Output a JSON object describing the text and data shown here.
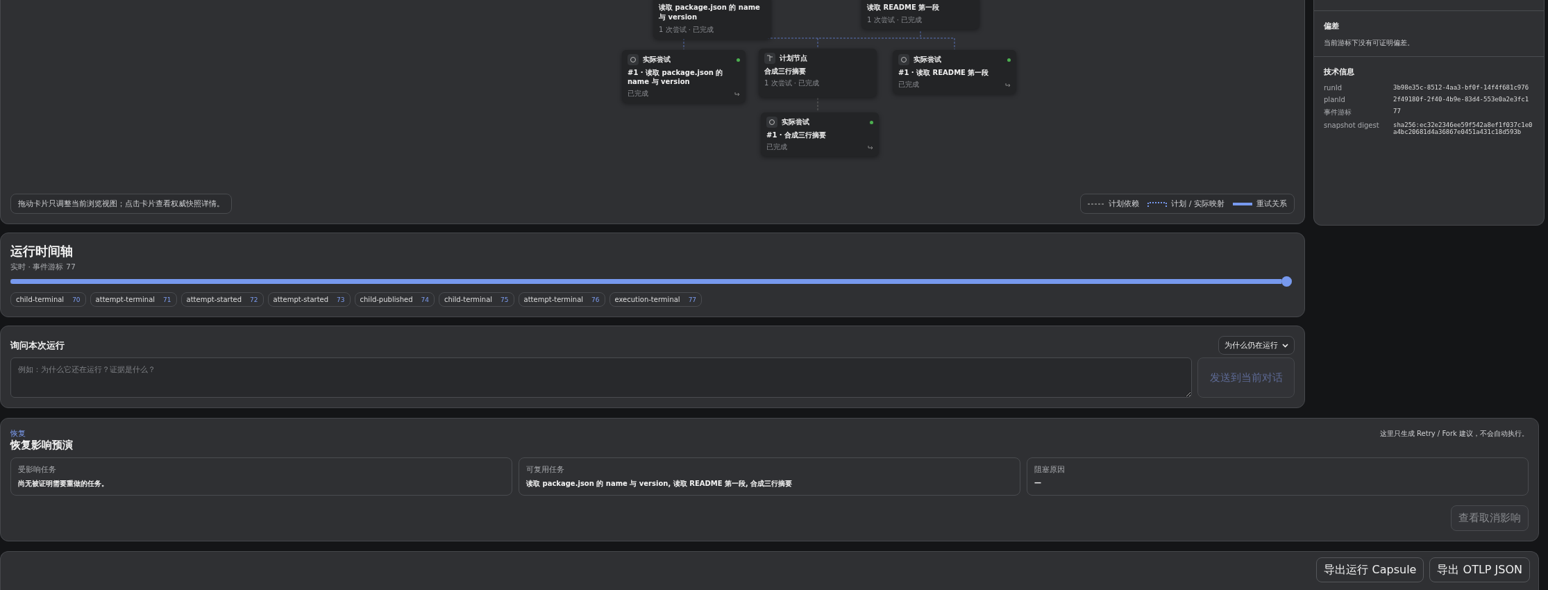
{
  "graph": {
    "nodes": [
      {
        "kind": "planned",
        "title": "读取 package.json 的 name 与 version",
        "meta": "1 次尝试 · 已完成"
      },
      {
        "kind": "planned",
        "title": "读取 README 第一段",
        "meta": "1 次尝试 · 已完成"
      },
      {
        "kind": "attempt",
        "title": "实际尝试",
        "task": "#1 · 读取 package.json 的 name 与 version",
        "status": "已完成"
      },
      {
        "kind": "plan",
        "title": "计划节点",
        "task": "合成三行摘要",
        "meta": "1 次尝试 · 已完成"
      },
      {
        "kind": "attempt",
        "title": "实际尝试",
        "task": "#1 · 读取 README 第一段",
        "status": "已完成"
      },
      {
        "kind": "attempt",
        "title": "实际尝试",
        "task": "#1 · 合成三行摘要",
        "status": "已完成"
      }
    ],
    "hint": "拖动卡片只调整当前浏览视图；点击卡片查看权威快照详情。",
    "legend": [
      {
        "kind": "dashed",
        "label": "计划依赖"
      },
      {
        "kind": "mapping",
        "label": "计划 / 实际映射"
      },
      {
        "kind": "retry",
        "label": "重试关系"
      }
    ]
  },
  "timeline": {
    "title": "运行时间轴",
    "subtitle": "实时 · 事件游标 77",
    "level": 1,
    "events": [
      {
        "name": "child-terminal",
        "seq": "70"
      },
      {
        "name": "attempt-terminal",
        "seq": "71"
      },
      {
        "name": "attempt-started",
        "seq": "72"
      },
      {
        "name": "attempt-started",
        "seq": "73"
      },
      {
        "name": "child-published",
        "seq": "74"
      },
      {
        "name": "child-terminal",
        "seq": "75"
      },
      {
        "name": "attempt-terminal",
        "seq": "76"
      },
      {
        "name": "execution-terminal",
        "seq": "77"
      }
    ]
  },
  "ask": {
    "title": "询问本次运行",
    "select": "为什么仍在运行",
    "placeholder": "例如：为什么它还在运行？证据是什么？",
    "send": {
      "label": "发送到当前对话",
      "disabled": true
    }
  },
  "recovery": {
    "eyebrow": "恢复",
    "title": "恢复影响预演",
    "note": "这里只生成 Retry / Fork 建议，不会自动执行。",
    "cards": [
      {
        "label": "受影响任务",
        "value": "尚无被证明需要重做的任务。"
      },
      {
        "label": "可复用任务",
        "value": "读取 package.json 的 name 与 version, 读取 README 第一段, 合成三行摘要"
      },
      {
        "label": "阻塞原因",
        "value": "—"
      }
    ],
    "button": {
      "label": "查看取消影响",
      "disabled": true
    }
  },
  "exports": [
    "导出运行 Capsule",
    "导出 OTLP JSON"
  ],
  "side": {
    "drift": {
      "title": "偏差",
      "text": "当前游标下没有可证明偏差。"
    },
    "tech": {
      "title": "技术信息",
      "rows": [
        {
          "key": "runId",
          "value": "3b98e35c-8512-4aa3-bf0f-14f4f681c976"
        },
        {
          "key": "planId",
          "value": "2f49180f-2f40-4b9e-83d4-553e0a2e3fc1"
        },
        {
          "key": "事件游标",
          "value": "77"
        },
        {
          "key": "snapshot digest",
          "value": "sha256:ec32e2346ee59f542a8ef1f037c1e0a4bc20681d4a36867e0451a431c18d593b"
        }
      ]
    }
  }
}
